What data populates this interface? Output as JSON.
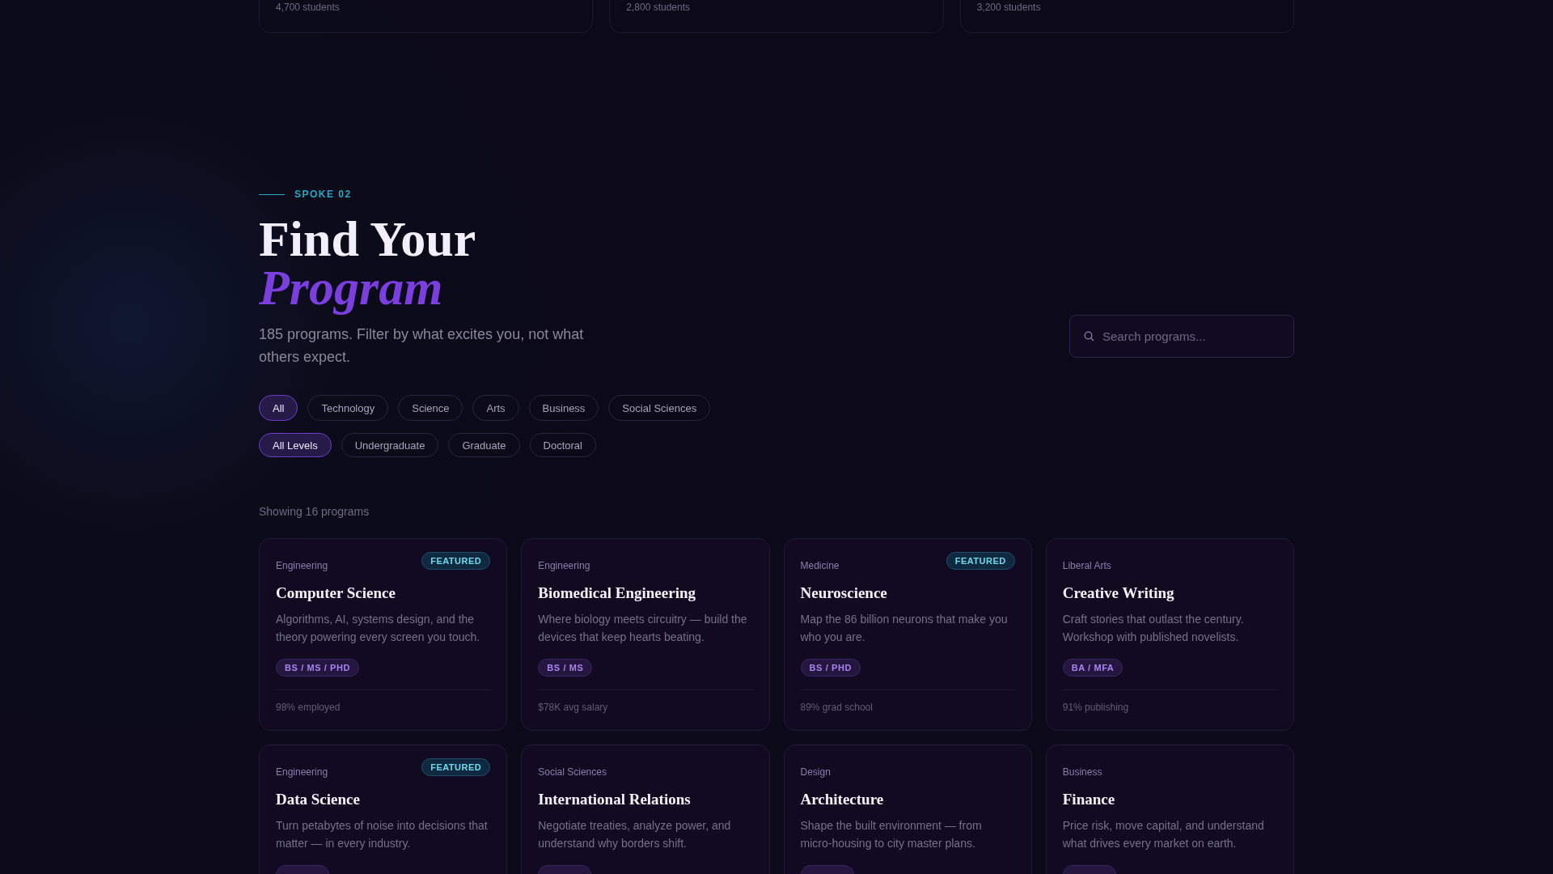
{
  "top_cards": [
    {
      "students": "4,700 students"
    },
    {
      "students": "2,800 students"
    },
    {
      "students": "3,200 students"
    }
  ],
  "section": {
    "eyebrow": "SPOKE 02",
    "title_line1": "Find Your",
    "title_line2": "Program",
    "subtitle": "185 programs. Filter by what excites you, not what others expect."
  },
  "search": {
    "placeholder": "Search programs..."
  },
  "field_filters": [
    {
      "label": "All",
      "selected": true
    },
    {
      "label": "Technology",
      "selected": false
    },
    {
      "label": "Science",
      "selected": false
    },
    {
      "label": "Arts",
      "selected": false
    },
    {
      "label": "Business",
      "selected": false
    },
    {
      "label": "Social Sciences",
      "selected": false
    }
  ],
  "level_filters": [
    {
      "label": "All Levels",
      "selected": true
    },
    {
      "label": "Undergraduate",
      "selected": false
    },
    {
      "label": "Graduate",
      "selected": false
    },
    {
      "label": "Doctoral",
      "selected": false
    }
  ],
  "results_count": "Showing 16 programs",
  "programs": [
    {
      "category": "Engineering",
      "featured": true,
      "featured_label": "FEATURED",
      "title": "Computer Science",
      "description": "Algorithms, AI, systems design, and the theory powering every screen you touch.",
      "degrees": "BS / MS / PHD",
      "stat": "98% employed"
    },
    {
      "category": "Engineering",
      "featured": false,
      "title": "Biomedical Engineering",
      "description": "Where biology meets circuitry — build the devices that keep hearts beating.",
      "degrees": "BS / MS",
      "stat": "$78K avg salary"
    },
    {
      "category": "Medicine",
      "featured": true,
      "featured_label": "FEATURED",
      "title": "Neuroscience",
      "description": "Map the 86 billion neurons that make you who you are.",
      "degrees": "BS / PHD",
      "stat": "89% grad school"
    },
    {
      "category": "Liberal Arts",
      "featured": false,
      "title": "Creative Writing",
      "description": "Craft stories that outlast the century. Workshop with published novelists.",
      "degrees": "BA / MFA",
      "stat": "91% publishing"
    },
    {
      "category": "Engineering",
      "featured": true,
      "featured_label": "FEATURED",
      "title": "Data Science",
      "description": "Turn petabytes of noise into decisions that matter — in every industry."
    },
    {
      "category": "Social Sciences",
      "featured": false,
      "title": "International Relations",
      "description": "Negotiate treaties, analyze power, and understand why borders shift."
    },
    {
      "category": "Design",
      "featured": false,
      "title": "Architecture",
      "description": "Shape the built environment — from micro-housing to city master plans."
    },
    {
      "category": "Business",
      "featured": false,
      "title": "Finance",
      "description": "Price risk, move capital, and understand what drives every market on earth."
    }
  ]
}
